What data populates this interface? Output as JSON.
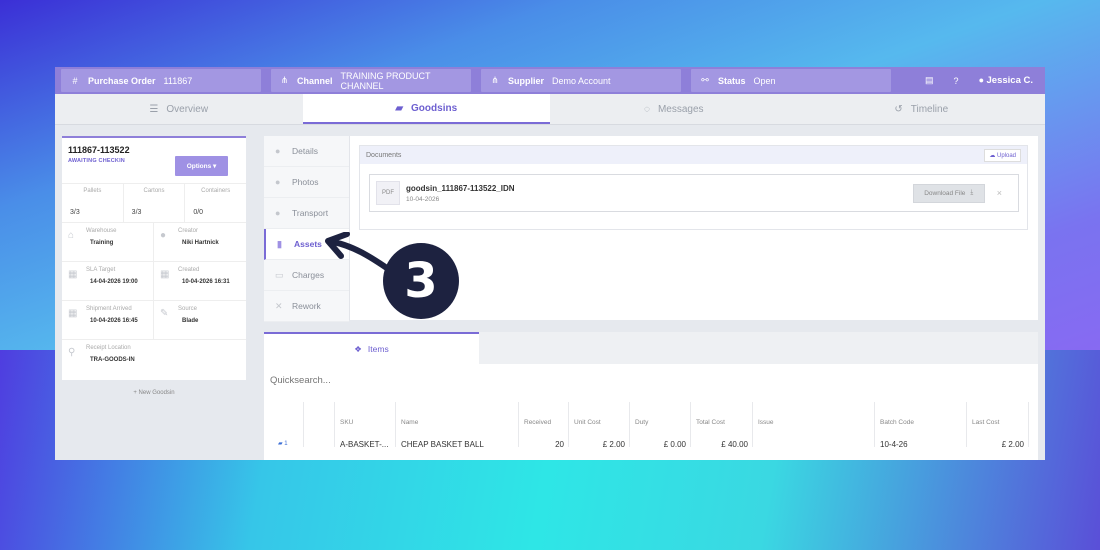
{
  "topbar": {
    "purchase_order_label": "Purchase Order",
    "purchase_order_value": "111867",
    "channel_label": "Channel",
    "channel_value": "TRAINING PRODUCT CHANNEL",
    "supplier_label": "Supplier",
    "supplier_value": "Demo Account",
    "status_label": "Status",
    "status_value": "Open",
    "user_name": "Jessica C."
  },
  "main_tabs": [
    {
      "label": "Overview",
      "icon": "list-icon"
    },
    {
      "label": "Goodsins",
      "icon": "truck-icon"
    },
    {
      "label": "Messages",
      "icon": "chat-icon"
    },
    {
      "label": "Timeline",
      "icon": "history-icon"
    }
  ],
  "goodsin": {
    "id": "111867-113522",
    "status": "AWAITING CHECKIN",
    "options_label": "Options ▾",
    "counts": [
      {
        "label": "Pallets",
        "value": "3/3"
      },
      {
        "label": "Cartons",
        "value": "3/3"
      },
      {
        "label": "Containers",
        "value": "0/0"
      }
    ],
    "fields": [
      {
        "label": "Warehouse",
        "value": "Training",
        "icon": "warehouse-icon"
      },
      {
        "label": "Creator",
        "value": "Niki Hartnick",
        "icon": "user-icon"
      },
      {
        "label": "SLA Target",
        "value": "14-04-2026 19:00",
        "icon": "calendar-icon"
      },
      {
        "label": "Created",
        "value": "10-04-2026 16:31",
        "icon": "calendar-icon"
      },
      {
        "label": "Shipment Arrived",
        "value": "10-04-2026 16:45",
        "icon": "calendar-icon"
      },
      {
        "label": "Source",
        "value": "Blade",
        "icon": "satellite-icon"
      },
      {
        "label": "Receipt Location",
        "value": "TRA-GOODS-IN",
        "icon": "location-icon"
      }
    ],
    "new_goodsin_label": "+ New Goodsin"
  },
  "side_tabs": [
    {
      "label": "Details"
    },
    {
      "label": "Photos"
    },
    {
      "label": "Transport"
    },
    {
      "label": "Assets"
    },
    {
      "label": "Charges"
    },
    {
      "label": "Rework"
    }
  ],
  "documents": {
    "title": "Documents",
    "upload_label": "Upload",
    "file_type": "PDF",
    "file_name": "goodsin_111867-113522_IDN",
    "file_date": "10-04-2026",
    "download_label": "Download File"
  },
  "items": {
    "tab_label": "Items",
    "quicksearch_placeholder": "Quicksearch...",
    "columns": [
      "SKU",
      "Name",
      "Received",
      "Unit Cost",
      "Duty",
      "Total Cost",
      "Issue",
      "Batch Code",
      "Last Cost"
    ],
    "rows": [
      {
        "index": "1",
        "sku": "A-BASKET-...",
        "name": "CHEAP BASKET BALL",
        "received": "20",
        "unit_cost": "£ 2.00",
        "duty": "£ 0.00",
        "total_cost": "£ 40.00",
        "issue": "",
        "batch_code": "10-4-26",
        "last_cost": "£ 2.00"
      }
    ]
  },
  "annotation": {
    "step_number": "3"
  }
}
